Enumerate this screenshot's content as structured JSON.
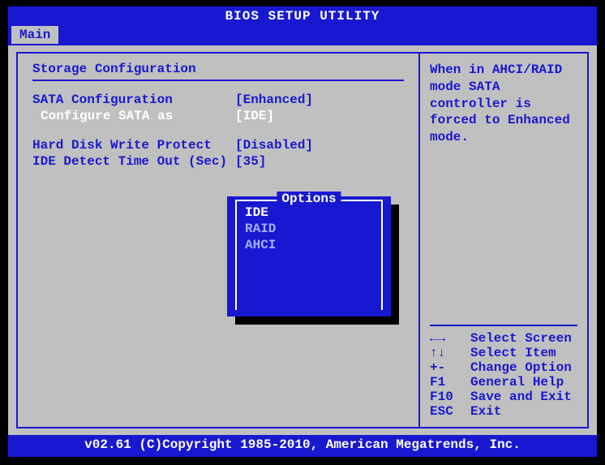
{
  "title": "BIOS SETUP UTILITY",
  "tab": "Main",
  "section_title": "Storage Configuration",
  "settings": {
    "sata_config": {
      "label": "SATA Configuration",
      "value": "[Enhanced]"
    },
    "configure_sata_as": {
      "label": "Configure SATA as",
      "value": "[IDE]"
    },
    "hd_write_protect": {
      "label": "Hard Disk Write Protect",
      "value": "[Disabled]"
    },
    "ide_timeout": {
      "label": "IDE Detect Time Out (Sec)",
      "value": "[35]"
    }
  },
  "popup": {
    "title": "Options",
    "options": [
      "IDE",
      "RAID",
      "AHCI"
    ],
    "selected": "IDE"
  },
  "help_text": "When in AHCI/RAID mode SATA controller is forced to Enhanced mode.",
  "keyhelp": [
    {
      "key": "←→",
      "desc": "Select Screen"
    },
    {
      "key": "↑↓",
      "desc": "Select Item"
    },
    {
      "key": "+-",
      "desc": "Change Option"
    },
    {
      "key": "F1",
      "desc": "General Help"
    },
    {
      "key": "F10",
      "desc": "Save and Exit"
    },
    {
      "key": "ESC",
      "desc": "Exit"
    }
  ],
  "footer": "v02.61 (C)Copyright 1985-2010, American Megatrends, Inc."
}
